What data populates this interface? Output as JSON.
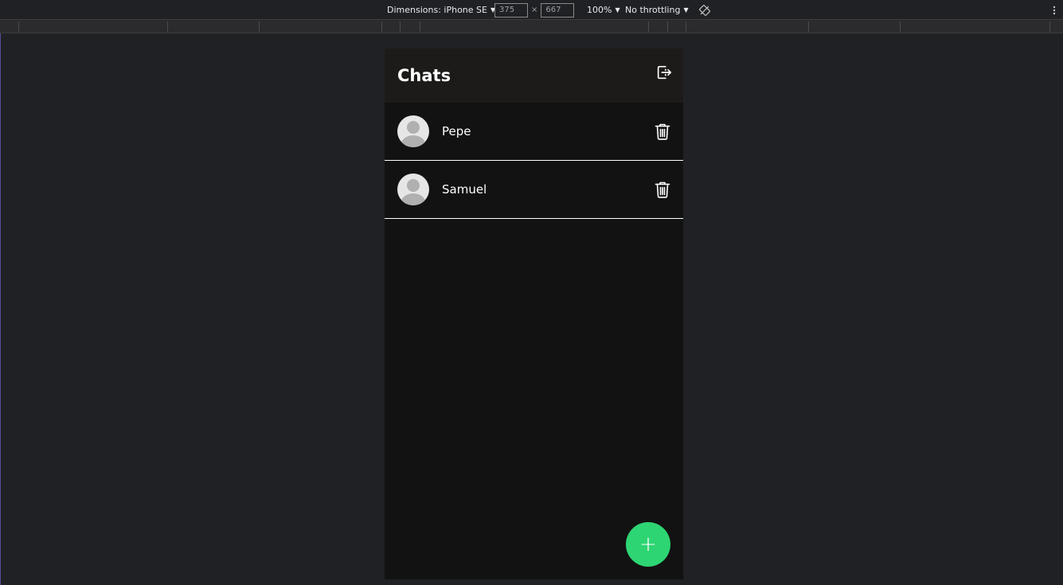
{
  "devtools": {
    "dimensions_label": "Dimensions: iPhone SE",
    "width_value": "375",
    "height_value": "667",
    "times": "×",
    "zoom_label": "100%",
    "throttling_label": "No throttling"
  },
  "app": {
    "title": "Chats",
    "chats": [
      {
        "name": "Pepe"
      },
      {
        "name": "Samuel"
      }
    ],
    "fab_label": "+",
    "colors": {
      "accent": "#2ed573",
      "header_bg": "#1c1b19",
      "list_bg": "#121212"
    }
  },
  "icons": {
    "logout": "logout-icon",
    "delete": "trash-icon",
    "rotate": "rotate-icon",
    "more": "more-vertical-icon"
  }
}
